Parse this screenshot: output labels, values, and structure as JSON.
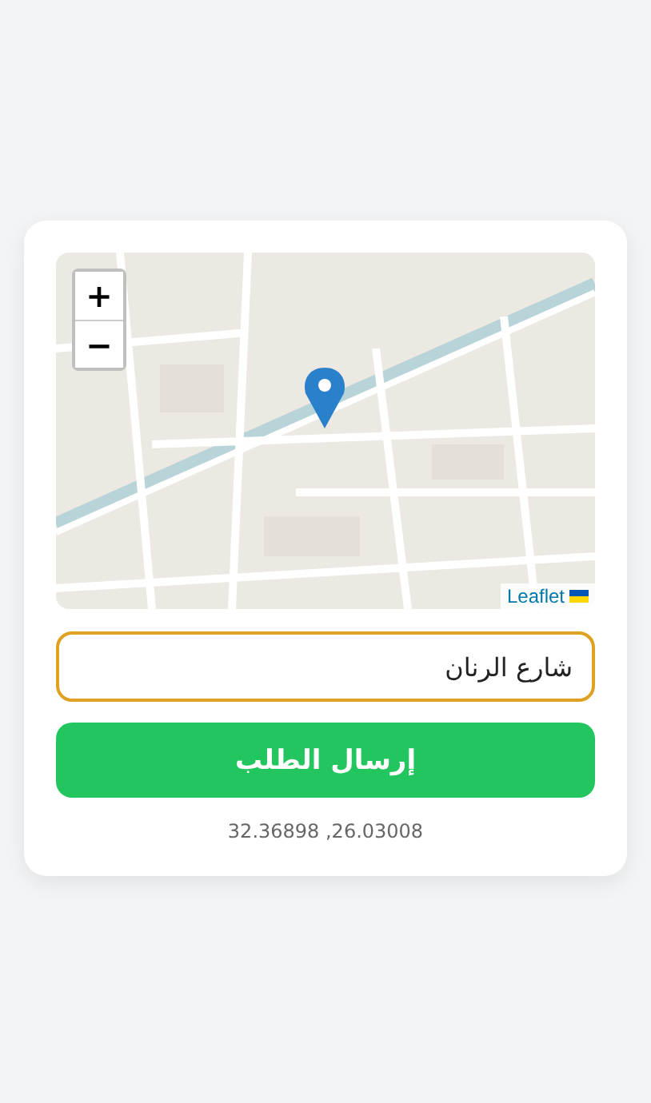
{
  "map": {
    "zoom_in": "+",
    "zoom_out": "−",
    "attribution": "Leaflet"
  },
  "address_field": {
    "value": "شارع الرنان"
  },
  "submit_button": {
    "label": "إرسال الطلب"
  },
  "coordinates": "32.36898 ,26.03008"
}
